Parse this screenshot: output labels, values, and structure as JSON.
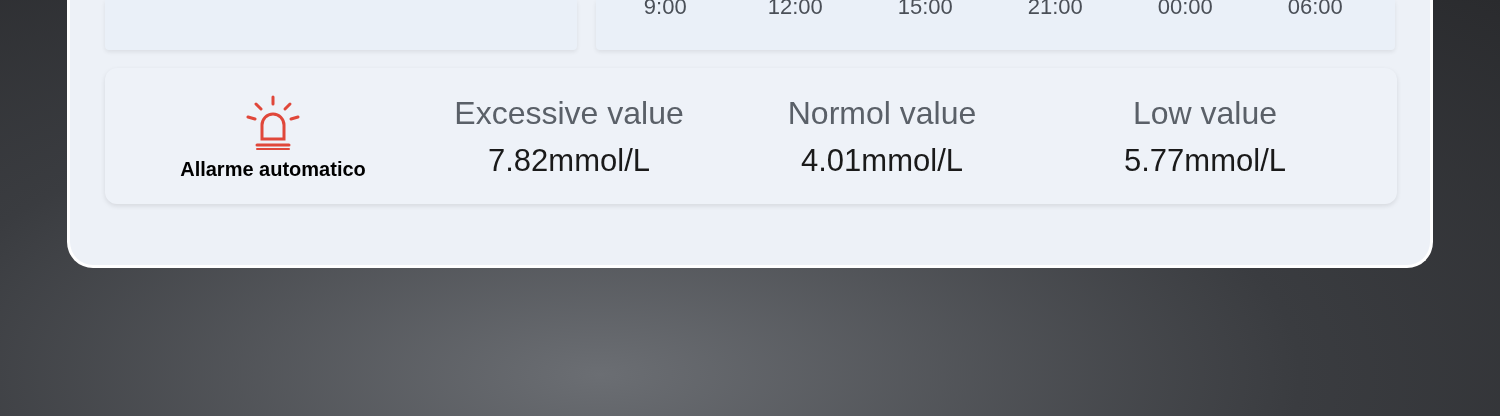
{
  "chart_axis": {
    "time_labels": [
      "9:00",
      "12:00",
      "15:00",
      "21:00",
      "00:00",
      "06:00"
    ]
  },
  "alarm": {
    "label": "Allarme automatico"
  },
  "readings": [
    {
      "label": "Excessive value",
      "value": "7.82mmol/L"
    },
    {
      "label": "Normol value",
      "value": "4.01mmol/L"
    },
    {
      "label": "Low value",
      "value": "5.77mmol/L"
    }
  ]
}
